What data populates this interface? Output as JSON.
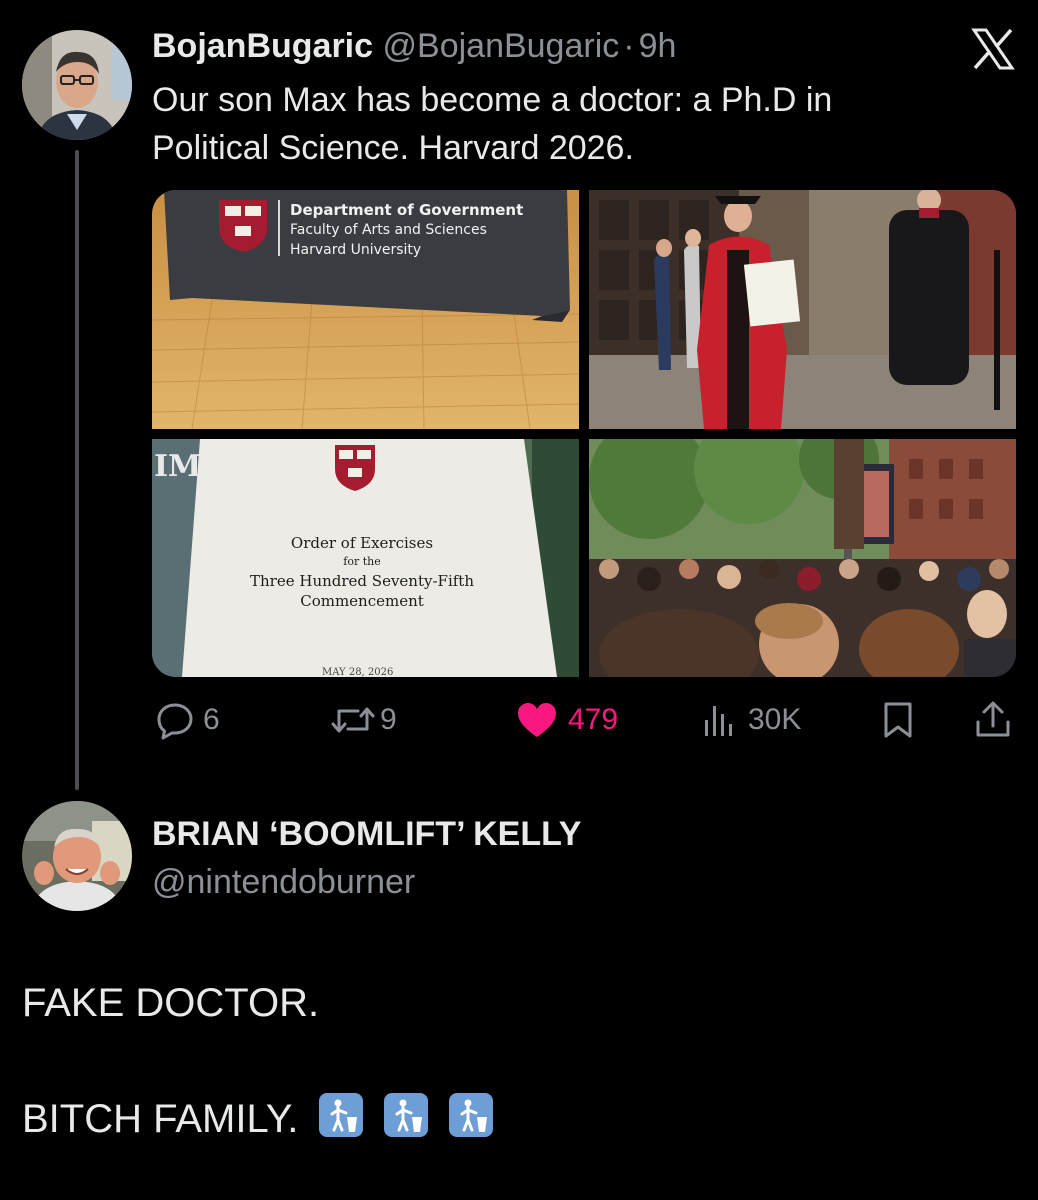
{
  "tweet": {
    "display_name": "BojanBugaric",
    "handle": "@BojanBugaric",
    "separator": "·",
    "time": "9h",
    "text_line1": "Our son Max has become a doctor: a Ph.D in",
    "text_line2": "Political Science. Harvard 2026.",
    "avatar_icon": "person-portrait-icon",
    "logo_icon": "x-logo-icon"
  },
  "media": {
    "photo1": {
      "table_title": "Department of Government",
      "table_line2": "Faculty of Arts and Sciences",
      "table_line3": "Harvard University",
      "shield_top": "VE RI",
      "shield_bottom": "TAS"
    },
    "photo3": {
      "shield_top": "VE RI",
      "shield_bottom": "TAS",
      "side_text": "IM",
      "line1": "Order of Exercises",
      "line2": "for the",
      "line3": "Three Hundred Seventy-Fifth",
      "line4": "Commencement",
      "date": "MAY 28, 2026"
    }
  },
  "actions": {
    "replies": "6",
    "retweets": "9",
    "likes": "479",
    "views": "30K",
    "colors": {
      "muted": "#8b9096",
      "like": "#f91880"
    }
  },
  "reply": {
    "display_name": "BRIAN ‘BOOMLIFT’ KELLY",
    "handle": "@nintendoburner",
    "line1": "FAKE DOCTOR.",
    "line2": "BITCH FAMILY.",
    "emoji_icon": "put-litter-in-its-place-icon"
  }
}
